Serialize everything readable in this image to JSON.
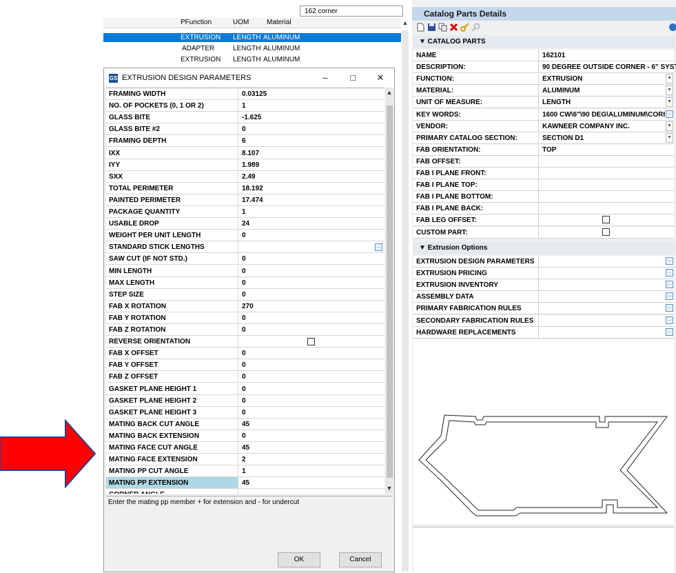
{
  "background_list": {
    "search_value": "162 corner",
    "columns": [
      "PFunction",
      "UOM",
      "Material"
    ],
    "rows": [
      {
        "function": "EXTRUSION",
        "uom": "LENGTH",
        "material": "ALUMINUM",
        "selected": true
      },
      {
        "function": "ADAPTER",
        "uom": "LENGTH",
        "material": "ALUMINUM",
        "selected": false
      },
      {
        "function": "EXTRUSION",
        "uom": "LENGTH",
        "material": "ALUMINUM",
        "selected": false
      }
    ]
  },
  "dialog": {
    "app_icon": "GS",
    "title": "EXTRUSION DESIGN PARAMETERS",
    "minimize": "–",
    "maximize": "□",
    "close": "✕",
    "params": [
      {
        "name": "FRAMING WIDTH",
        "value": "0.03125"
      },
      {
        "name": "NO. OF POCKETS (0, 1 OR 2)",
        "value": "1"
      },
      {
        "name": "GLASS BITE",
        "value": "-1.625"
      },
      {
        "name": "GLASS BITE #2",
        "value": "0"
      },
      {
        "name": "FRAMING DEPTH",
        "value": "6"
      },
      {
        "name": "IXX",
        "value": "8.107"
      },
      {
        "name": "IYY",
        "value": "1.989"
      },
      {
        "name": "SXX",
        "value": "2.49"
      },
      {
        "name": "TOTAL PERIMETER",
        "value": "18.192"
      },
      {
        "name": "PAINTED PERIMETER",
        "value": "17.474"
      },
      {
        "name": "PACKAGE QUANTITY",
        "value": "1"
      },
      {
        "name": "USABLE DROP",
        "value": "24"
      },
      {
        "name": "WEIGHT PER UNIT LENGTH",
        "value": "0"
      },
      {
        "name": "STANDARD STICK LENGTHS",
        "value": ""
      },
      {
        "name": "SAW CUT (IF NOT STD.)",
        "value": "0"
      },
      {
        "name": "MIN LENGTH",
        "value": "0"
      },
      {
        "name": "MAX LENGTH",
        "value": "0"
      },
      {
        "name": "STEP SIZE",
        "value": "0"
      },
      {
        "name": "FAB X ROTATION",
        "value": "270"
      },
      {
        "name": "FAB Y ROTATION",
        "value": "0"
      },
      {
        "name": "FAB Z ROTATION",
        "value": "0"
      },
      {
        "name": "REVERSE ORIENTATION",
        "value": ""
      },
      {
        "name": "FAB X OFFSET",
        "value": "0"
      },
      {
        "name": "FAB Y OFFSET",
        "value": "0"
      },
      {
        "name": "FAB Z OFFSET",
        "value": "0"
      },
      {
        "name": "GASKET PLANE HEIGHT 1",
        "value": "0"
      },
      {
        "name": "GASKET PLANE HEIGHT 2",
        "value": "0"
      },
      {
        "name": "GASKET PLANE HEIGHT 3",
        "value": "0"
      },
      {
        "name": "MATING BACK CUT ANGLE",
        "value": "45"
      },
      {
        "name": "MATING BACK EXTENSION",
        "value": "0"
      },
      {
        "name": "MATING FACE CUT ANGLE",
        "value": "45"
      },
      {
        "name": "MATING FACE EXTENSION",
        "value": "2"
      },
      {
        "name": "MATING PP CUT ANGLE",
        "value": "1"
      },
      {
        "name": "MATING PP EXTENSION",
        "value": "45"
      },
      {
        "name": "CORNER ANGLE",
        "value": ""
      }
    ],
    "description": "Enter the mating pp member + for extension and - for undercut",
    "ok_label": "OK",
    "cancel_label": "Cancel"
  },
  "right_panel": {
    "title": "Catalog Parts Details",
    "section_catalog": "▼  CATALOG PARTS",
    "catalog_rows": [
      {
        "name": "NAME",
        "value": "162101"
      },
      {
        "name": "DESCRIPTION:",
        "value": "90 DEGREE OUTSIDE CORNER - 6\" SYST"
      },
      {
        "name": "FUNCTION:",
        "value": "EXTRUSION"
      },
      {
        "name": "MATERIAL:",
        "value": "ALUMINUM"
      },
      {
        "name": "UNIT OF MEASURE:",
        "value": "LENGTH"
      },
      {
        "name": "KEY WORDS:",
        "value": "1600 CW\\6\"\\90 DEG\\ALUMINUM\\CORI"
      },
      {
        "name": "VENDOR:",
        "value": "KAWNEER COMPANY INC."
      },
      {
        "name": "PRIMARY CATALOG SECTION:",
        "value": "SECTION D1"
      },
      {
        "name": "FAB ORIENTATION:",
        "value": "TOP"
      },
      {
        "name": "FAB OFFSET:",
        "value": ""
      },
      {
        "name": "FAB I PLANE FRONT:",
        "value": ""
      },
      {
        "name": "FAB I PLANE TOP:",
        "value": ""
      },
      {
        "name": "FAB I PLANE BOTTOM:",
        "value": ""
      },
      {
        "name": "FAB I PLANE BACK:",
        "value": ""
      },
      {
        "name": "FAB LEG OFFSET:",
        "value": ""
      },
      {
        "name": "CUSTOM PART:",
        "value": ""
      }
    ],
    "section_extrusion": "▼  Extrusion Options",
    "extrusion_rows": [
      {
        "name": "EXTRUSION DESIGN PARAMETERS"
      },
      {
        "name": "EXTRUSION PRICING"
      },
      {
        "name": "EXTRUSION INVENTORY"
      },
      {
        "name": "ASSEMBLY DATA"
      },
      {
        "name": "PRIMARY FABRICATION RULES"
      },
      {
        "name": "SECONDARY FABRICATION RULES"
      },
      {
        "name": "HARDWARE REPLACEMENTS"
      }
    ]
  },
  "colors": {
    "arrow": "#ff0000",
    "selection": "#0a7ad6",
    "highlight": "#add8e6"
  }
}
